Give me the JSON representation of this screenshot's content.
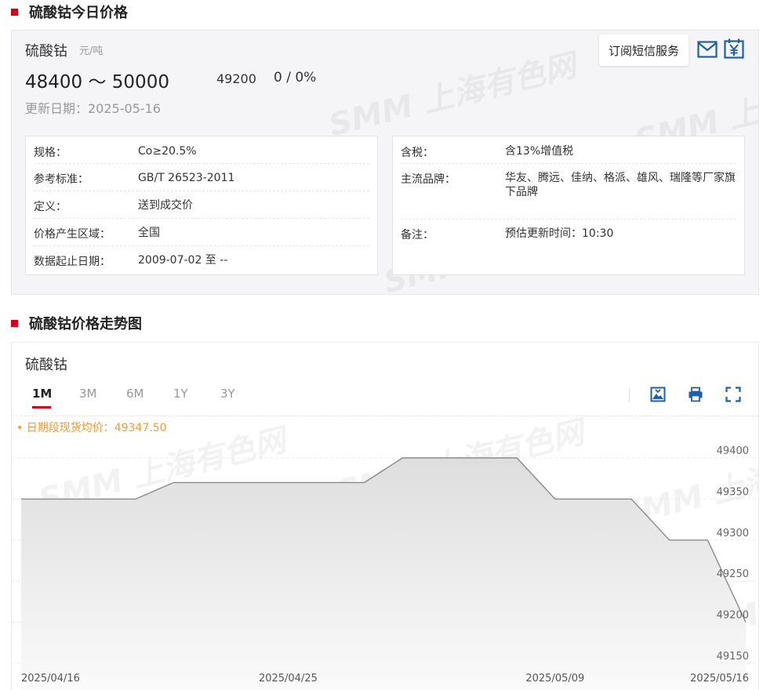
{
  "section1": {
    "title": "硫酸钴今日价格"
  },
  "product": {
    "name": "硫酸钴",
    "unit": "元/吨",
    "price_range": "48400 ～ 50000",
    "avg_price": "49200",
    "change": "0 / 0%",
    "updated": "更新日期：2025-05-16"
  },
  "actions": {
    "sms_label": "订阅短信服务",
    "mail_icon": "mail-icon",
    "calendar_icon": "calendar-yen-icon"
  },
  "watermark": "SMM 上海有色网",
  "specs_left": [
    {
      "label": "规格：",
      "value": "Co≥20.5%"
    },
    {
      "label": "参考标准：",
      "value": "GB/T 26523-2011"
    },
    {
      "label": "定义：",
      "value": "送到成交价"
    },
    {
      "label": "价格产生区域：",
      "value": "全国"
    },
    {
      "label": "数据起止日期：",
      "value": "2009-07-02 至 --"
    }
  ],
  "specs_right": [
    {
      "label": "含税：",
      "value": "含13%增值税"
    },
    {
      "label": "主流品牌：",
      "value": "华友、腾远、佳纳、格派、雄风、瑞隆等厂家旗下品牌"
    },
    {
      "label": "备注：",
      "value": "预估更新时间：10:30"
    }
  ],
  "section2": {
    "title": "硫酸钴价格走势图"
  },
  "chart_panel": {
    "name": "硫酸钴",
    "tabs": [
      "1M",
      "3M",
      "6M",
      "1Y",
      "3Y"
    ],
    "active_tab": "1M",
    "avg_label": "• 日期段现货均价：49347.50",
    "tools": [
      "download-image-icon",
      "print-icon",
      "fullscreen-icon"
    ]
  },
  "colors": {
    "accent": "#d0021b",
    "avg_label": "#f39a3d",
    "line": "#888888",
    "area_top": "#e2e2e2"
  },
  "chart_data": {
    "type": "area",
    "x": [
      "2025/04/16",
      "2025/04/17",
      "2025/04/18",
      "2025/04/21",
      "2025/04/22",
      "2025/04/23",
      "2025/04/24",
      "2025/04/25",
      "2025/04/28",
      "2025/04/29",
      "2025/04/30",
      "2025/05/06",
      "2025/05/07",
      "2025/05/08",
      "2025/05/09",
      "2025/05/12",
      "2025/05/13",
      "2025/05/14",
      "2025/05/15",
      "2025/05/16"
    ],
    "series": [
      {
        "values": [
          49350,
          49350,
          49350,
          49350,
          49370,
          49370,
          49370,
          49370,
          49370,
          49370,
          49400,
          49400,
          49400,
          49400,
          49350,
          49350,
          49350,
          49300,
          49300,
          49200
        ]
      }
    ],
    "x_tick_labels": [
      "2025/04/16",
      "2025/04/25",
      "2025/05/09",
      "2025/05/16"
    ],
    "y_ticks": [
      49400,
      49350,
      49300,
      49250,
      49200,
      49150
    ],
    "ylim": [
      49150,
      49420
    ],
    "grid": true,
    "title": "",
    "xlabel": "",
    "ylabel": ""
  }
}
